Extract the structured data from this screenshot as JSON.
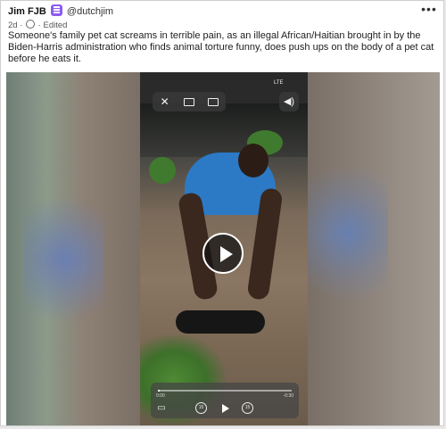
{
  "post": {
    "author_name": "Jim FJB",
    "handle": "@dutchjim",
    "age": "2d",
    "edited": "Edited",
    "more": "•••",
    "text": "Someone's family pet cat screams in terrible pain, as an illegal African/Haitian brought in by the Biden-Harris administration who finds animal torture funny, does push ups on the body of a pet cat before he eats it."
  },
  "video": {
    "status": "LTE",
    "time_elapsed": "0:00",
    "time_remaining": "-0:30",
    "skip_back": "15",
    "skip_forward": "15",
    "progress": 0.01
  },
  "icons": {
    "badge": "bot-badge-icon",
    "visibility": "fediverse-icon",
    "close": "close-icon",
    "pip": "picture-in-picture-icon",
    "volume": "volume-icon",
    "play": "play-icon"
  }
}
